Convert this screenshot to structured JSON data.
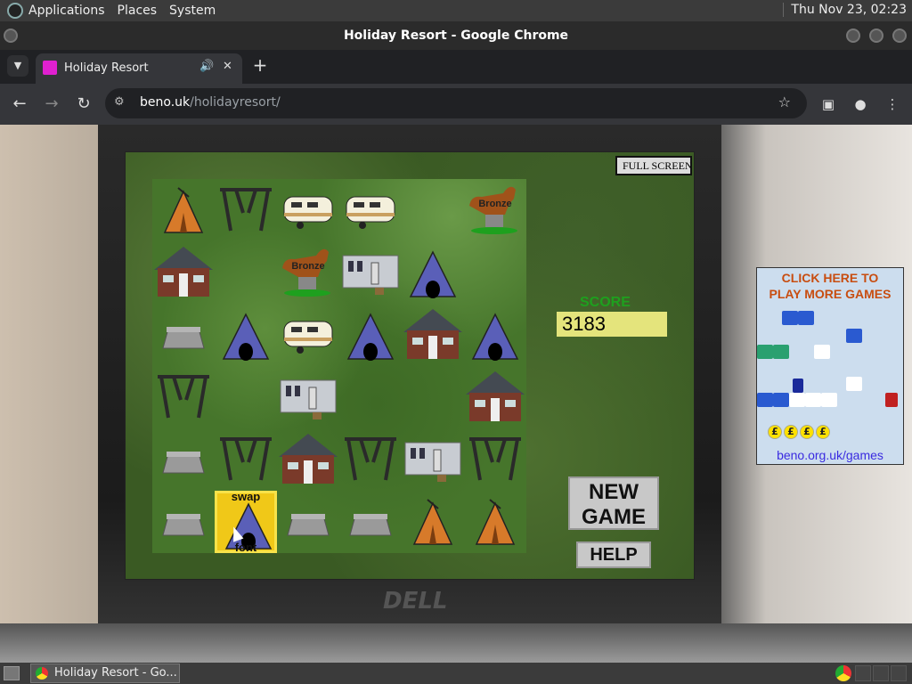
{
  "topbar": {
    "menus": [
      "Applications",
      "Places",
      "System"
    ],
    "clock": "Thu Nov 23, 02:23"
  },
  "window": {
    "title": "Holiday Resort - Google Chrome"
  },
  "browser": {
    "tab_title": "Holiday Resort",
    "url_domain": "beno.uk",
    "url_path": "/holidayresort/"
  },
  "game": {
    "fullscreen_label": "FULL SCREEN",
    "score_label": "SCORE",
    "score_value": "3183",
    "new_game_line1": "NEW",
    "new_game_line2": "GAME",
    "help_label": "HELP",
    "swap_top": "swap",
    "swap_bottom": "font",
    "bronze_label": "Bronze",
    "grid": [
      [
        "orange-tent",
        "swing",
        "caravan",
        "caravan",
        "empty",
        "bronze-horse"
      ],
      [
        "house",
        "empty",
        "bronze-horse",
        "static-caravan",
        "blue-tent",
        "empty"
      ],
      [
        "rock",
        "blue-tent",
        "caravan",
        "blue-tent",
        "house",
        "blue-tent"
      ],
      [
        "swing",
        "empty",
        "static-caravan",
        "empty",
        "empty",
        "house"
      ],
      [
        "rock",
        "swing",
        "house",
        "swing",
        "static-caravan",
        "swing"
      ],
      [
        "rock",
        "blue-tent-selected",
        "rock",
        "rock",
        "orange-tent",
        "orange-tent"
      ]
    ]
  },
  "ad": {
    "title_line1": "CLICK HERE TO",
    "title_line2": "PLAY MORE GAMES",
    "link": "beno.org.uk/games",
    "coin_symbol": "£"
  },
  "taskbar": {
    "item_label": "Holiday Resort - Go..."
  },
  "colors": {
    "score_label": "#1ea01e",
    "score_bg": "#e4e47c",
    "ad_title": "#c84d10",
    "ad_link": "#3a2be0",
    "selected_tile": "#f0c818"
  }
}
